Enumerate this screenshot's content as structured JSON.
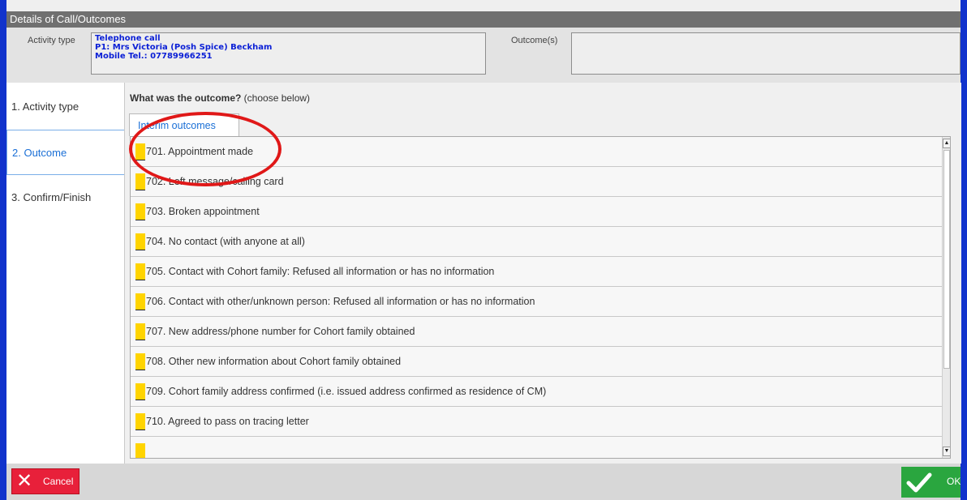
{
  "window": {
    "title": "Details of Call/Outcomes"
  },
  "header": {
    "activity_label": "Activity type",
    "activity_lines": [
      "Telephone call",
      "P1: Mrs Victoria (Posh Spice) Beckham",
      "Mobile Tel.: 07789966251"
    ],
    "outcome_label": "Outcome(s)",
    "outcome_value": ""
  },
  "sidebar": {
    "items": [
      {
        "label": "1. Activity type"
      },
      {
        "label": "2. Outcome"
      },
      {
        "label": "3. Confirm/Finish"
      }
    ]
  },
  "main": {
    "question_bold": "What was the outcome?",
    "question_rest": " (choose below)",
    "tab_label": "Interim outcomes",
    "outcomes": [
      "701. Appointment made",
      "702. Left message/calling card",
      "703. Broken appointment",
      "704. No contact (with anyone at all)",
      "705. Contact with Cohort family: Refused all information or has no information",
      "706. Contact with other/unknown person:  Refused all information or has no information",
      "707. New address/phone number for Cohort family obtained",
      "708. Other new information about Cohort family obtained",
      "709. Cohort family address confirmed (i.e. issued address confirmed as residence of CM)",
      "710. Agreed to pass on tracing letter"
    ]
  },
  "footer": {
    "cancel_label": "Cancel",
    "ok_label": "OK"
  },
  "colors": {
    "accent_blue": "#1133cc",
    "marker_yellow": "#ffd400",
    "cancel_red": "#e8203a",
    "ok_green": "#2aa63f",
    "annotation_red": "#e01818"
  }
}
